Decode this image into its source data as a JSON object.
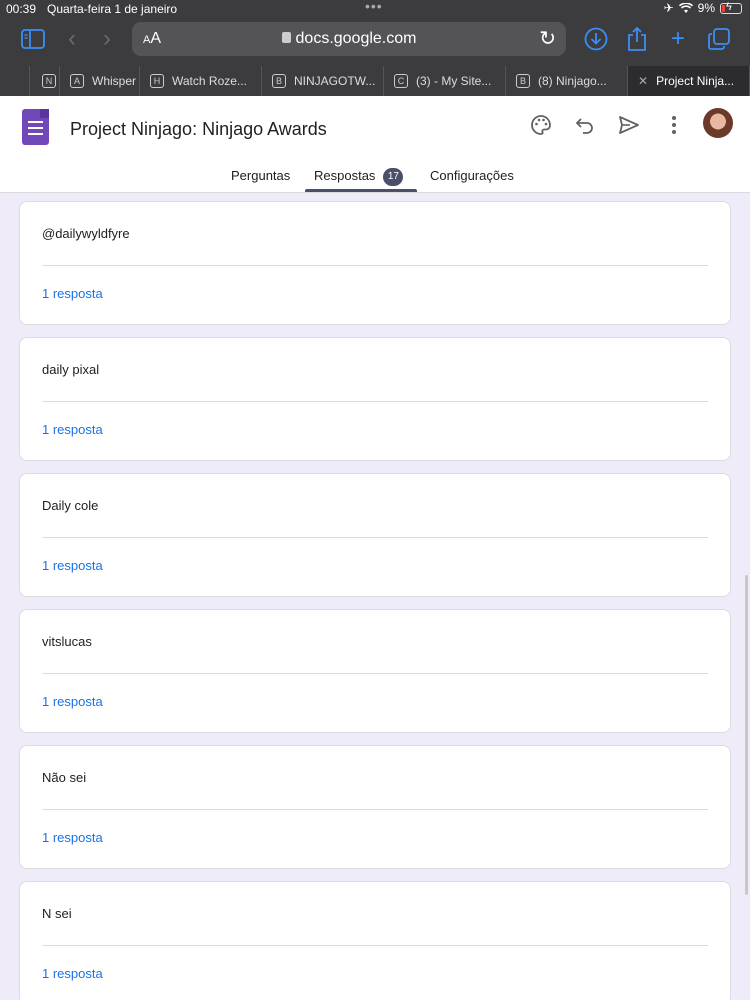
{
  "status_bar": {
    "time": "00:39",
    "date": "Quarta-feira 1 de janeiro",
    "battery": "9%"
  },
  "browser": {
    "text_size": "AA",
    "url": "docs.google.com",
    "tabs": [
      {
        "icon": "N",
        "label": ""
      },
      {
        "icon": "A",
        "label": "Whisper"
      },
      {
        "icon": "H",
        "label": "Watch Roze..."
      },
      {
        "icon": "B",
        "label": "NINJAGOTW..."
      },
      {
        "icon": "C",
        "label": "(3) - My Site..."
      },
      {
        "icon": "B",
        "label": "(8) Ninjago..."
      },
      {
        "icon": "",
        "label": "Project Ninja..."
      }
    ]
  },
  "form": {
    "title": "Project Ninjago: Ninjago Awards",
    "tabs": {
      "questions": "Perguntas",
      "responses": "Respostas",
      "responses_count": "17",
      "settings": "Configurações"
    }
  },
  "responses": [
    {
      "answer": "@dailywyldfyre",
      "count": "1 resposta"
    },
    {
      "answer": "daily pixal",
      "count": "1 resposta"
    },
    {
      "answer": "Daily cole",
      "count": "1 resposta"
    },
    {
      "answer": "vitslucas",
      "count": "1 resposta"
    },
    {
      "answer": "Não sei",
      "count": "1 resposta"
    },
    {
      "answer": "N sei",
      "count": "1 resposta"
    }
  ]
}
